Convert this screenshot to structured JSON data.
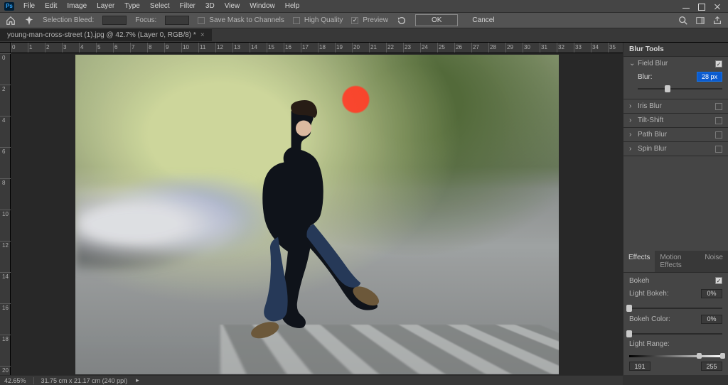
{
  "app": {
    "logo": "Ps"
  },
  "menu": [
    "File",
    "Edit",
    "Image",
    "Layer",
    "Type",
    "Select",
    "Filter",
    "3D",
    "View",
    "Window",
    "Help"
  ],
  "options_bar": {
    "selection_bleed_label": "Selection Bleed:",
    "focus_label": "Focus:",
    "save_mask_label": "Save Mask to Channels",
    "high_quality_label": "High Quality",
    "preview_label": "Preview",
    "ok_label": "OK",
    "cancel_label": "Cancel",
    "preview_checked": true,
    "high_quality_checked": false,
    "save_mask_checked": false
  },
  "document_tab": {
    "title": "young-man-cross-street (1).jpg @ 42.7% (Layer 0, RGB/8) *"
  },
  "ruler_labels_h": [
    "0",
    "1",
    "2",
    "3",
    "4",
    "5",
    "6",
    "7",
    "8",
    "9",
    "10",
    "11",
    "12",
    "13",
    "14",
    "15",
    "16",
    "17",
    "18",
    "19",
    "20",
    "21",
    "22",
    "23",
    "24",
    "25",
    "26",
    "27",
    "28",
    "29",
    "30",
    "31",
    "32",
    "33",
    "34",
    "35"
  ],
  "ruler_labels_v": [
    "0",
    "2",
    "4",
    "6",
    "8",
    "10",
    "12",
    "14",
    "16",
    "18",
    "20"
  ],
  "blur_tools": {
    "header": "Blur Tools",
    "items": [
      {
        "name": "Field Blur",
        "expanded": true,
        "enabled": true,
        "param_label": "Blur:",
        "param_value": "28 px",
        "slider_pct": 35
      },
      {
        "name": "Iris Blur",
        "expanded": false,
        "enabled": false
      },
      {
        "name": "Tilt-Shift",
        "expanded": false,
        "enabled": false
      },
      {
        "name": "Path Blur",
        "expanded": false,
        "enabled": false
      },
      {
        "name": "Spin Blur",
        "expanded": false,
        "enabled": false
      }
    ]
  },
  "effects": {
    "tabs": [
      "Effects",
      "Motion Effects",
      "Noise"
    ],
    "active_tab": 0,
    "bokeh_label": "Bokeh",
    "bokeh_enabled": true,
    "light_bokeh_label": "Light Bokeh:",
    "light_bokeh_value": "0%",
    "light_bokeh_pct": 0,
    "bokeh_color_label": "Bokeh Color:",
    "bokeh_color_value": "0%",
    "bokeh_color_pct": 0,
    "light_range_label": "Light Range:",
    "light_range_low": "191",
    "light_range_high": "255",
    "light_range_low_pct": 75,
    "light_range_high_pct": 100
  },
  "status": {
    "zoom": "42.65%",
    "doc_size": "31.75 cm x 21.17 cm (240 ppi)"
  }
}
